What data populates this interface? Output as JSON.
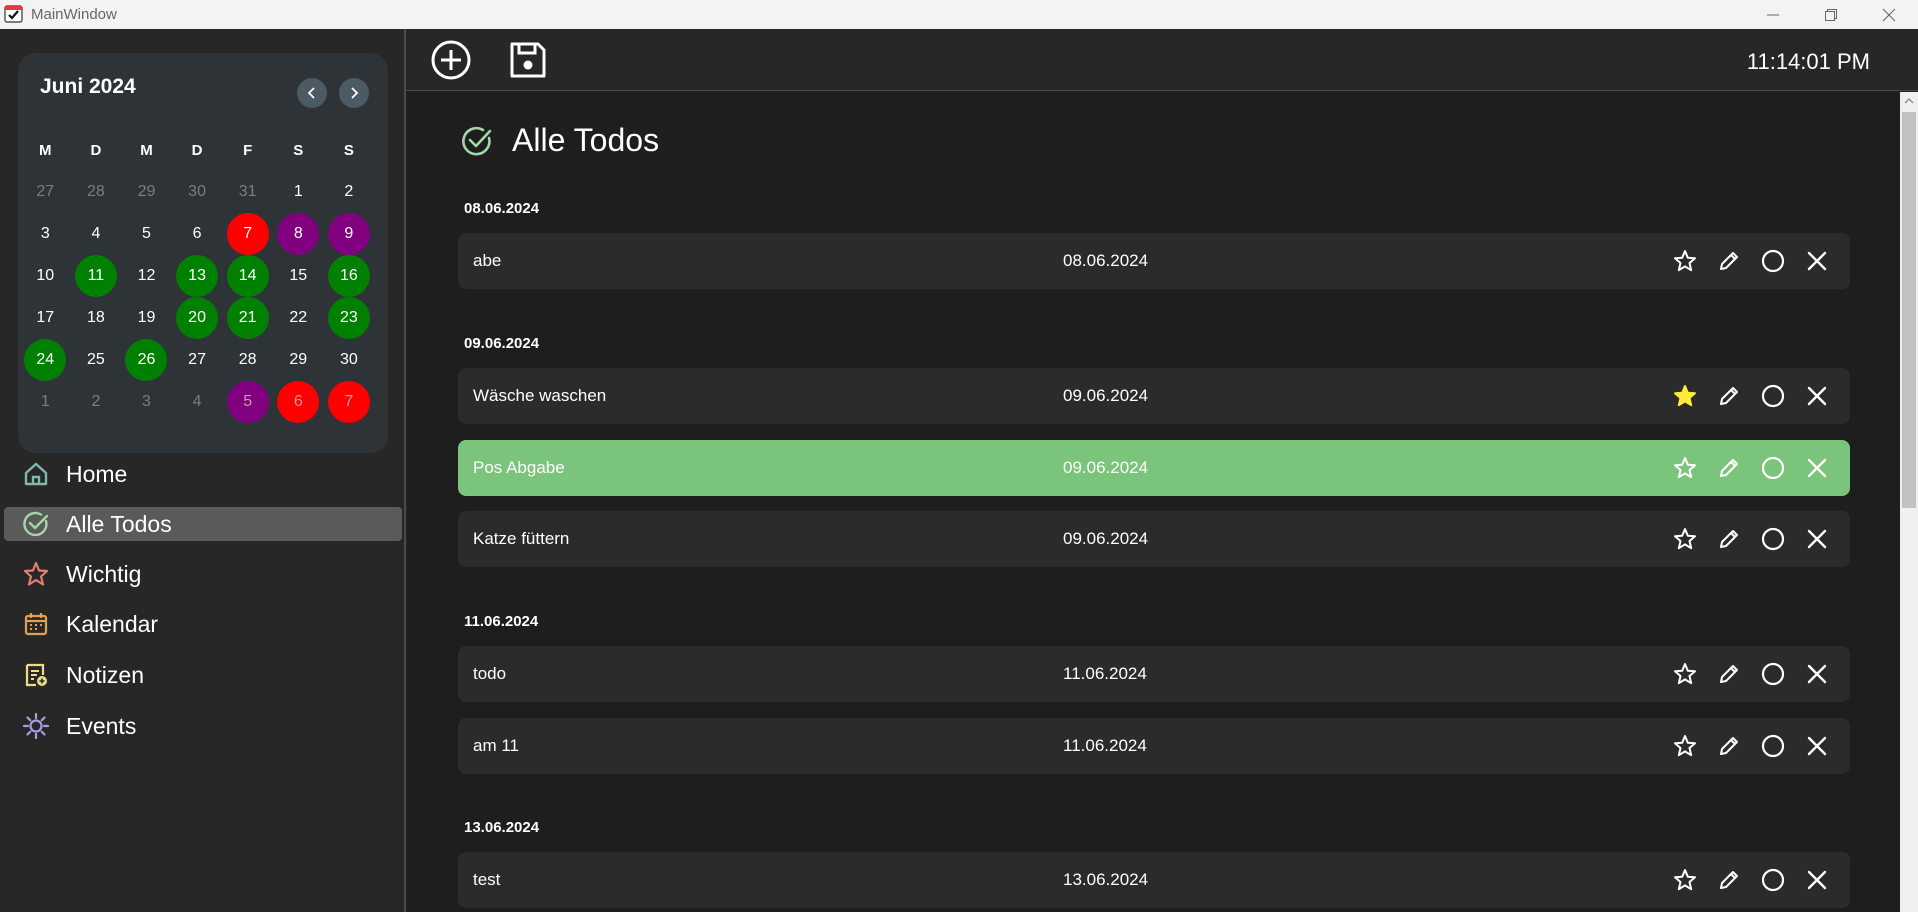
{
  "window": {
    "title": "MainWindow"
  },
  "toolbar": {
    "clock": "11:14:01 PM",
    "add_icon": "add-circle-icon",
    "save_icon": "save-icon"
  },
  "calendar": {
    "month_label": "Juni 2024",
    "weekday_headers": [
      "M",
      "D",
      "M",
      "D",
      "F",
      "S",
      "S"
    ],
    "days": [
      {
        "d": "27",
        "m": true
      },
      {
        "d": "28",
        "m": true
      },
      {
        "d": "29",
        "m": true
      },
      {
        "d": "30",
        "m": true
      },
      {
        "d": "31",
        "m": true
      },
      {
        "d": "1"
      },
      {
        "d": "2"
      },
      {
        "d": "3"
      },
      {
        "d": "4"
      },
      {
        "d": "5"
      },
      {
        "d": "6"
      },
      {
        "d": "7",
        "c": "red"
      },
      {
        "d": "8",
        "c": "purple"
      },
      {
        "d": "9",
        "c": "purple"
      },
      {
        "d": "10"
      },
      {
        "d": "11",
        "c": "green"
      },
      {
        "d": "12"
      },
      {
        "d": "13",
        "c": "green"
      },
      {
        "d": "14",
        "c": "green"
      },
      {
        "d": "15"
      },
      {
        "d": "16",
        "c": "green"
      },
      {
        "d": "17"
      },
      {
        "d": "18"
      },
      {
        "d": "19"
      },
      {
        "d": "20",
        "c": "green"
      },
      {
        "d": "21",
        "c": "green"
      },
      {
        "d": "22"
      },
      {
        "d": "23",
        "c": "green"
      },
      {
        "d": "24",
        "c": "green"
      },
      {
        "d": "25"
      },
      {
        "d": "26",
        "c": "green"
      },
      {
        "d": "27"
      },
      {
        "d": "28"
      },
      {
        "d": "29"
      },
      {
        "d": "30"
      },
      {
        "d": "1",
        "m": true
      },
      {
        "d": "2",
        "m": true
      },
      {
        "d": "3",
        "m": true
      },
      {
        "d": "4",
        "m": true
      },
      {
        "d": "5",
        "m": true,
        "c": "purple"
      },
      {
        "d": "6",
        "m": true,
        "c": "red"
      },
      {
        "d": "7",
        "m": true,
        "c": "red"
      }
    ]
  },
  "nav": [
    {
      "label": "Home",
      "icon": "home-icon",
      "active": false
    },
    {
      "label": "Alle Todos",
      "icon": "check-circle-icon",
      "active": true
    },
    {
      "label": "Wichtig",
      "icon": "star-icon",
      "active": false
    },
    {
      "label": "Kalendar",
      "icon": "calendar-icon",
      "active": false
    },
    {
      "label": "Notizen",
      "icon": "notes-icon",
      "active": false
    },
    {
      "label": "Events",
      "icon": "sun-icon",
      "active": false
    }
  ],
  "main": {
    "title": "Alle Todos",
    "groups": [
      {
        "date": "08.06.2024",
        "todos": [
          {
            "name": "abe",
            "date": "08.06.2024",
            "starred": false,
            "selected": false
          }
        ]
      },
      {
        "date": "09.06.2024",
        "todos": [
          {
            "name": "Wäsche waschen",
            "date": "09.06.2024",
            "starred": true,
            "selected": false
          },
          {
            "name": "Pos Abgabe",
            "date": "09.06.2024",
            "starred": false,
            "selected": true
          },
          {
            "name": "Katze füttern",
            "date": "09.06.2024",
            "starred": false,
            "selected": false
          }
        ]
      },
      {
        "date": "11.06.2024",
        "todos": [
          {
            "name": "todo",
            "date": "11.06.2024",
            "starred": false,
            "selected": false
          },
          {
            "name": "am 11",
            "date": "11.06.2024",
            "starred": false,
            "selected": false
          }
        ]
      },
      {
        "date": "13.06.2024",
        "todos": [
          {
            "name": "test",
            "date": "13.06.2024",
            "starred": false,
            "selected": false
          }
        ]
      }
    ]
  },
  "colors": {
    "accent_green": "#7bc47b",
    "day_red": "#ff0000",
    "day_purple": "#800080",
    "day_green": "#008000",
    "star_active": "#ffeb3b"
  }
}
